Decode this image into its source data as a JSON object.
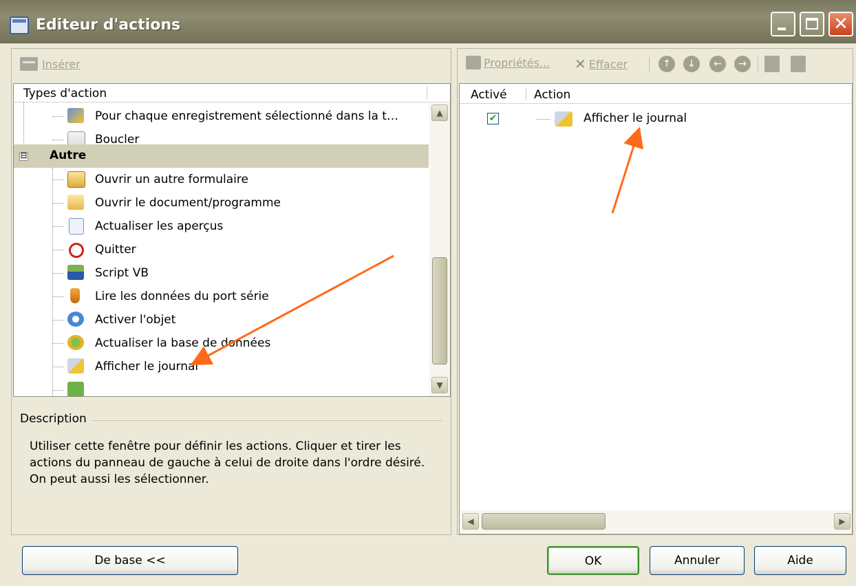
{
  "window": {
    "title": "Editeur d'actions",
    "close_glyph": "✕"
  },
  "left_toolbar": {
    "insert_label": "Insérer"
  },
  "tree": {
    "header": "Types d'action",
    "items_above": [
      {
        "label": "Pour chaque enregistrement sélectionné dans la t…",
        "icon": "foreach-records-icon"
      },
      {
        "label": "Boucler",
        "icon": "loop-icon"
      }
    ],
    "group": {
      "label": "Autre",
      "expander": "⊟"
    },
    "items": [
      {
        "label": "Ouvrir un autre formulaire",
        "icon": "open-form-icon"
      },
      {
        "label": "Ouvrir le document/programme",
        "icon": "open-document-icon"
      },
      {
        "label": "Actualiser les aperçus",
        "icon": "refresh-previews-icon"
      },
      {
        "label": "Quitter",
        "icon": "quit-icon"
      },
      {
        "label": "Script VB",
        "icon": "vb-script-icon"
      },
      {
        "label": "Lire les données du port série",
        "icon": "serial-port-icon"
      },
      {
        "label": "Activer l'objet",
        "icon": "activate-object-icon"
      },
      {
        "label": "Actualiser la base de données",
        "icon": "refresh-database-icon"
      },
      {
        "label": "Afficher le journal",
        "icon": "show-log-icon"
      }
    ]
  },
  "description": {
    "title": "Description",
    "text": "Utiliser cette fenêtre pour définir les actions. Cliquer et tirer les actions du panneau de gauche à celui de droite dans l'ordre désiré. On peut aussi les sélectionner."
  },
  "right_toolbar": {
    "properties_label": "Propriétés...",
    "delete_label": "Effacer",
    "delete_glyph": "✕"
  },
  "action_list": {
    "columns": [
      "Activé",
      "Action"
    ],
    "rows": [
      {
        "enabled": true,
        "check_glyph": "✔",
        "action": "Afficher le journal"
      }
    ]
  },
  "buttons": {
    "base": "De base <<",
    "ok": "OK",
    "cancel": "Annuler",
    "help": "Aide"
  },
  "colors": {
    "annotation_arrow": "#ff6a1a",
    "group_background": "#d1cfb5",
    "window_background": "#ece9d8"
  }
}
